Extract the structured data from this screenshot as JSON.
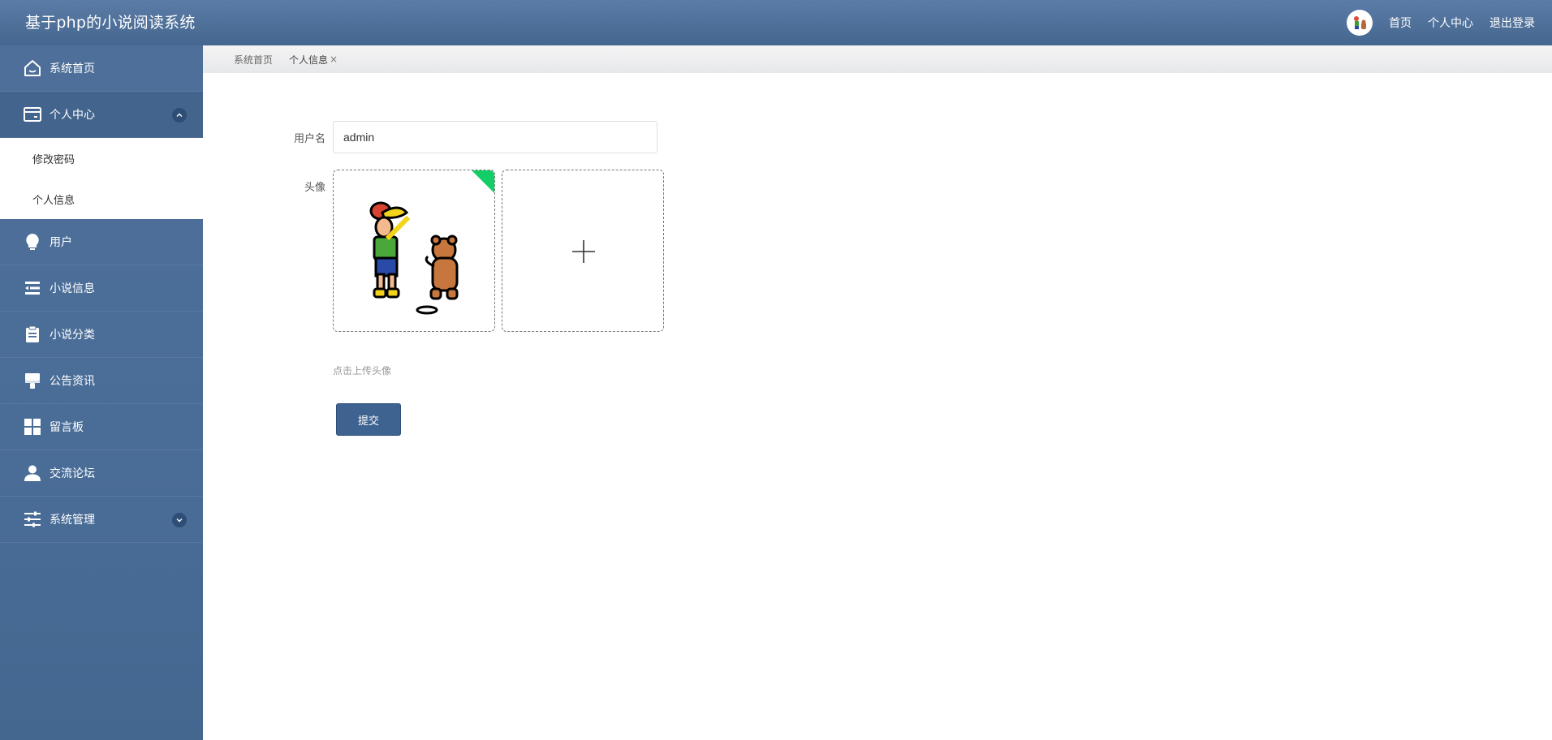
{
  "header": {
    "app_title": "基于php的小说阅读系统",
    "links": [
      "首页",
      "个人中心",
      "退出登录"
    ]
  },
  "sidebar": {
    "items": [
      {
        "label": "系统首页",
        "icon": "home-icon"
      },
      {
        "label": "个人中心",
        "icon": "card-icon",
        "expanded": true,
        "children": [
          "修改密码",
          "个人信息"
        ]
      },
      {
        "label": "用户",
        "icon": "bulb-icon"
      },
      {
        "label": "小说信息",
        "icon": "list-icon"
      },
      {
        "label": "小说分类",
        "icon": "clipboard-icon"
      },
      {
        "label": "公告资讯",
        "icon": "brush-icon"
      },
      {
        "label": "留言板",
        "icon": "grid-icon"
      },
      {
        "label": "交流论坛",
        "icon": "user-icon"
      },
      {
        "label": "系统管理",
        "icon": "sliders-icon",
        "expanded": false
      }
    ]
  },
  "breadcrumb": {
    "items": [
      "系统首页",
      "个人信息"
    ],
    "close_symbol": "×"
  },
  "form": {
    "username_label": "用户名",
    "username_value": "admin",
    "avatar_label": "头像",
    "upload_hint": "点击上传头像",
    "submit_label": "提交"
  },
  "colors": {
    "header_bg": "#4d6f99",
    "sidebar_bg": "#4a6d98",
    "button_bg": "#3f6391",
    "upload_success": "#13ce66"
  }
}
